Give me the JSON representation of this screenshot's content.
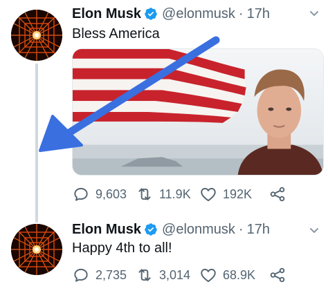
{
  "tweets": [
    {
      "author_name": "Elon Musk",
      "verified": true,
      "handle": "@elonmusk",
      "separator": "·",
      "time": "17h",
      "text": "Bless America",
      "has_media": true,
      "replies": "9,603",
      "retweets": "11.9K",
      "likes": "192K"
    },
    {
      "author_name": "Elon Musk",
      "verified": true,
      "handle": "@elonmusk",
      "separator": "·",
      "time": "17h",
      "text": "Happy 4th to all!",
      "has_media": false,
      "replies": "2,735",
      "retweets": "3,014",
      "likes": "68.9K"
    }
  ],
  "icons": {
    "verified": "verified-badge-icon",
    "more": "chevron-down-icon",
    "reply": "reply-icon",
    "retweet": "retweet-icon",
    "like": "heart-icon",
    "share": "share-icon"
  },
  "colors": {
    "verified_blue": "#1d9bf0",
    "annotation_arrow": "#3a6fe0",
    "secondary_text": "#536471",
    "thread_line": "#cfd9de"
  }
}
